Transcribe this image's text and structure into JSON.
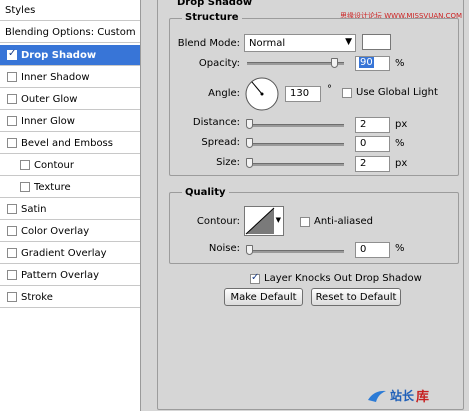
{
  "styles_panel": {
    "header": "Styles",
    "blending_options": "Blending Options: Custom",
    "items": [
      {
        "label": "Drop Shadow",
        "checked": true,
        "selected": true
      },
      {
        "label": "Inner Shadow",
        "checked": false
      },
      {
        "label": "Outer Glow",
        "checked": false
      },
      {
        "label": "Inner Glow",
        "checked": false
      },
      {
        "label": "Bevel and Emboss",
        "checked": false
      },
      {
        "label": "Contour",
        "checked": false
      },
      {
        "label": "Texture",
        "checked": false
      },
      {
        "label": "Satin",
        "checked": false
      },
      {
        "label": "Color Overlay",
        "checked": false
      },
      {
        "label": "Gradient Overlay",
        "checked": false
      },
      {
        "label": "Pattern Overlay",
        "checked": false
      },
      {
        "label": "Stroke",
        "checked": false
      }
    ]
  },
  "drop_shadow": {
    "title": "Drop Shadow",
    "structure": {
      "title": "Structure",
      "blend_mode_label": "Blend Mode:",
      "blend_mode_value": "Normal",
      "opacity_label": "Opacity:",
      "opacity_value": "90",
      "opacity_unit": "%",
      "opacity_level": 0.9,
      "angle_label": "Angle:",
      "angle_value": "130",
      "angle_unit": "°",
      "use_global_light": "Use Global Light",
      "distance_label": "Distance:",
      "distance_value": "2",
      "distance_unit": "px",
      "spread_label": "Spread:",
      "spread_value": "0",
      "spread_unit": "%",
      "size_label": "Size:",
      "size_value": "2",
      "size_unit": "px"
    },
    "quality": {
      "title": "Quality",
      "contour_label": "Contour:",
      "anti_aliased": "Anti-aliased",
      "noise_label": "Noise:",
      "noise_value": "0",
      "noise_unit": "%"
    },
    "layer_knocks_out": "Layer Knocks Out Drop Shadow",
    "make_default": "Make Default",
    "reset_default": "Reset to Default"
  },
  "watermark_top": "思缘设计论坛 WWW.MISSVUAN.COM",
  "watermark_bottom": "站长",
  "watermark_bottom_b": "库",
  "colors": {
    "selection": "#3875d7",
    "panel": "#d6d6d6",
    "shadow_swatch": "#ffffff"
  }
}
